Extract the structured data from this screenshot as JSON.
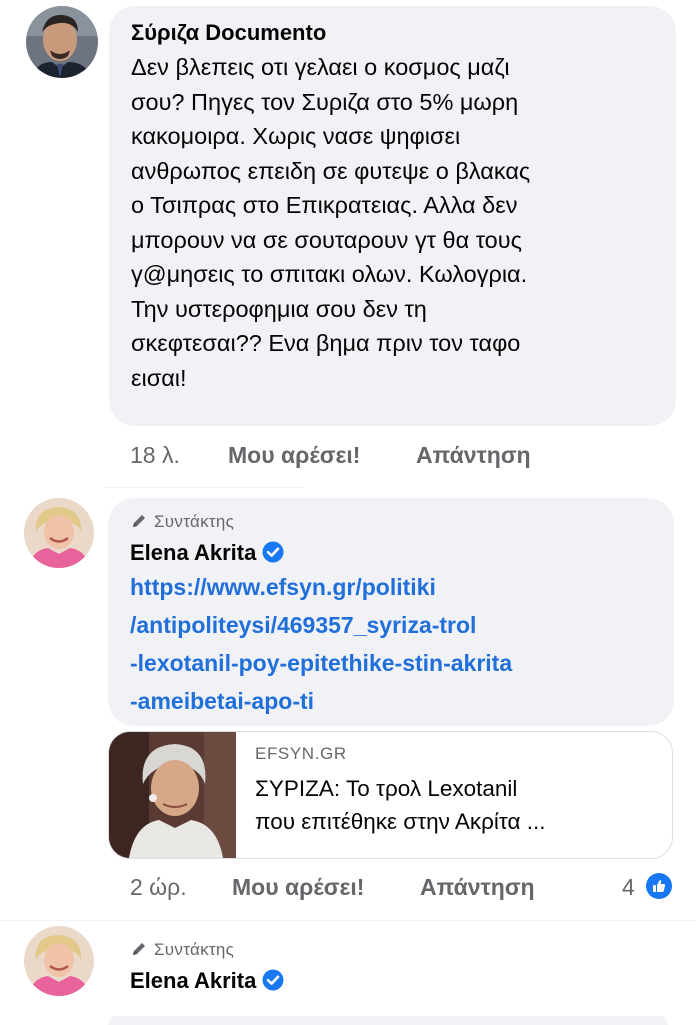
{
  "colors": {
    "bubble": "#f0f2f5",
    "link": "#216fdb",
    "meta": "#65676b",
    "verified": "#1877f2"
  },
  "comment1": {
    "author": "Σύριζα Documento",
    "lines": [
      "Δεν βλεπεις οτι γελαει ο κοσμος μαζι",
      "σου? Πηγες τον Συριζα στο 5% μωρη",
      "κακομοιρα. Χωρις νασε ψηφισει",
      "ανθρωπος επειδη σε φυτεψε ο βλακας",
      "ο Τσιπρας στο Επικρατειας. Αλλα δεν",
      "μπορουν να σε σουταρουν γτ θα τους",
      "γ@μησεις το σπιτακι ολων. Κωλογρια.",
      "Την υστεροφημια σου δεν τη",
      "σκεφτεσαι?? Ενα βημα πριν τον ταφο",
      "εισαι!"
    ],
    "time": "18 λ.",
    "like_label": "Μου αρέσει!",
    "reply_label": "Απάντηση"
  },
  "comment2": {
    "role": "Συντάκτης",
    "author": "Elena Akrita",
    "link_lines": [
      "https://www.efsyn.gr/politiki",
      "/antipoliteysi/469357_syriza-trol",
      "-lexotanil-poy-epitethike-stin-akrita",
      "-ameibetai-apo-ti"
    ],
    "preview": {
      "domain": "EFSYN.GR",
      "title_lines": [
        "ΣΥΡΙΖΑ: Το τρολ Lexotanil",
        "που επιτέθηκε στην Ακρίτα ..."
      ]
    },
    "time": "2 ώρ.",
    "like_label": "Μου αρέσει!",
    "reply_label": "Απάντηση",
    "reactions": "4"
  },
  "comment3": {
    "role": "Συντάκτης",
    "author": "Elena Akrita"
  }
}
